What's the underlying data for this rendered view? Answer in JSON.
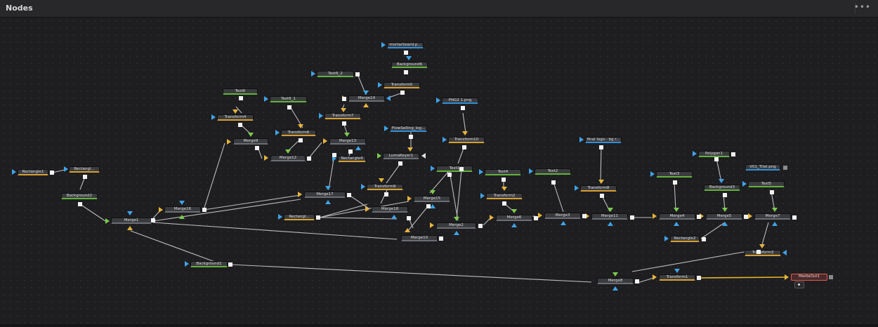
{
  "header": {
    "title": "Nodes",
    "menu_label": "•••"
  },
  "colors": {
    "link": "#bdbdbd",
    "link_active": "#e6b52b",
    "input_blue": "#3fa4e8",
    "input_yellow": "#e8b43a",
    "input_green": "#7bcc4a",
    "output": "#f2f2f2",
    "media_out_border": "#e05a4a"
  },
  "icons": {
    "node_options": "menu-dot-icon",
    "input": "triangle-icon",
    "output": "square-icon"
  },
  "nodes": {
    "rectangle1": "Rectangle1",
    "rectangle_a": "Rectangl...",
    "rectangle_b": "Rectangl...",
    "rectangle2": "Rectangle2",
    "rectangle4": "Rectangle4",
    "background1": "Background1",
    "background2": "Background2",
    "background3": "Background3",
    "background6": "Background6",
    "merge1": "Merge1",
    "merge2": "Merge2",
    "merge3": "Merge3",
    "merge4": "Merge4",
    "merge5": "Merge5",
    "merge6": "Merge6",
    "merge7": "Merge7",
    "merge8": "Merge8",
    "merge9": "Merge9",
    "merge10": "Merge10",
    "merge11": "Merge11",
    "merge12": "Merge12",
    "merge13": "Merge13",
    "merge14": "Merge14",
    "merge15": "Merge15",
    "merge16": "Merge16",
    "merge17": "Merge17",
    "merge18": "Merge18",
    "transform1": "Transform1",
    "transform2": "Transform2",
    "transform3": "Transform3",
    "transform4": "Transform4",
    "transform5": "Transform5",
    "transform6": "Transform6",
    "transform7": "Transform7",
    "transform8": "Transform8",
    "transform9": "Transform9",
    "transform10": "Transform10",
    "text1": "Text1",
    "text2": "Text2",
    "text3": "Text3",
    "text4": "Text4",
    "text5": "Text5",
    "text6": "Text6",
    "text6_1": "Text6_1",
    "text6_2": "Text6_2",
    "polygon1": "Polygon1",
    "lumakeyer1": "LumaKeyer1",
    "mortarboard": "mortarboard.p...",
    "png21": "PNG2 1.png",
    "flowselling": "FlowSelling_log...",
    "final_logo": "final logo - bg r...",
    "v01_titel": "V01_Titel.png",
    "mediaout1": "MediaOut1"
  }
}
